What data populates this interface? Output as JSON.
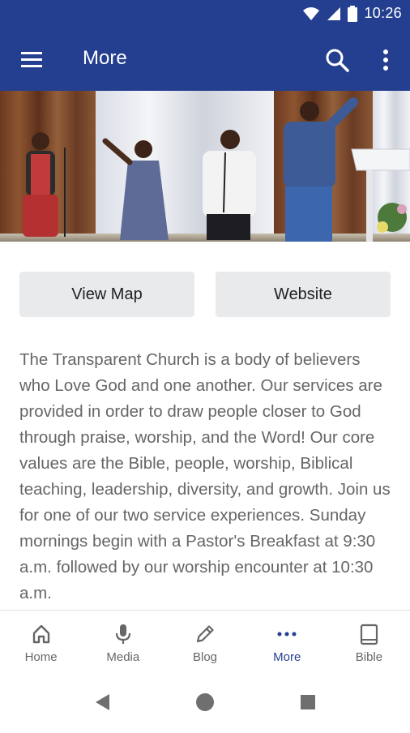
{
  "status_bar": {
    "time": "10:26",
    "icons": [
      "wifi-icon",
      "cellular-signal-icon",
      "battery-icon"
    ]
  },
  "app_bar": {
    "title": "More",
    "icons": [
      "hamburger-menu-icon",
      "search-icon",
      "more-vertical-icon"
    ]
  },
  "hero_image": {
    "description": "church worship team photo",
    "icon": "photo"
  },
  "actions": {
    "view_map": "View Map",
    "website": "Website"
  },
  "description": "The Transparent Church is a body of believers who Love God and one another. Our services are provided in order to draw people closer to God through praise, worship, and the Word! Our core values are the Bible, people, worship, Biblical teaching, leadership, diversity, and growth. Join us for one of our two service experiences. Sunday mornings begin with a Pastor's Breakfast at 9:30 a.m. followed by our worship encounter at 10:30 a.m.",
  "tabs": [
    {
      "label": "Home",
      "icon": "home-icon",
      "active": false
    },
    {
      "label": "Media",
      "icon": "microphone-icon",
      "active": false
    },
    {
      "label": "Blog",
      "icon": "pencil-icon",
      "active": false
    },
    {
      "label": "More",
      "icon": "more-horizontal-icon",
      "active": true
    },
    {
      "label": "Bible",
      "icon": "book-icon",
      "active": false
    }
  ],
  "colors": {
    "primary": "#243f8f",
    "button_bg": "#e9eaeb",
    "text_gray": "#666666"
  }
}
